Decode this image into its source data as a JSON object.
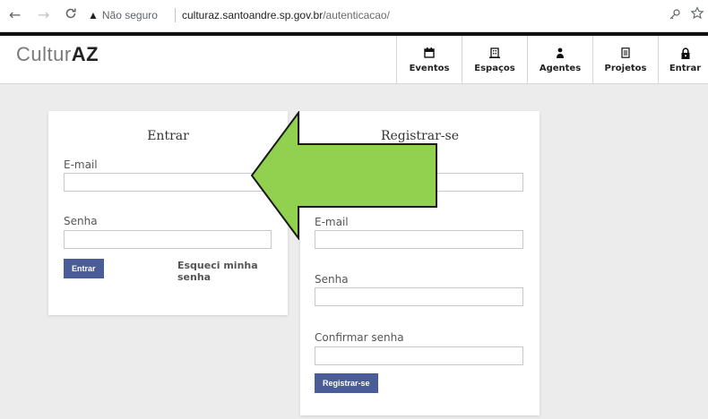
{
  "browser": {
    "back": "←",
    "forward": "→",
    "reload": "C",
    "security_text": "Não seguro",
    "url_domain": "culturaz.santoandre.sp.gov.br",
    "url_path": "/autenticacao/"
  },
  "site": {
    "logo_light": "Cultur",
    "logo_bold": "AZ",
    "menu": [
      {
        "icon": "calendar-icon",
        "label": "Eventos"
      },
      {
        "icon": "building-icon",
        "label": "Espaços"
      },
      {
        "icon": "person-icon",
        "label": "Agentes"
      },
      {
        "icon": "document-icon",
        "label": "Projetos"
      },
      {
        "icon": "lock-icon",
        "label": "Entrar"
      }
    ]
  },
  "login": {
    "title": "Entrar",
    "email_label": "E-mail",
    "password_label": "Senha",
    "submit_label": "Entrar",
    "forgot_label": "Esqueci minha senha"
  },
  "register": {
    "title": "Registrar-se",
    "email_label": "E-mail",
    "password_label": "Senha",
    "confirm_label": "Confirmar senha",
    "submit_label": "Registrar-se"
  },
  "overlay": {
    "arrow_color": "#92d050",
    "arrow_direction": "left"
  }
}
